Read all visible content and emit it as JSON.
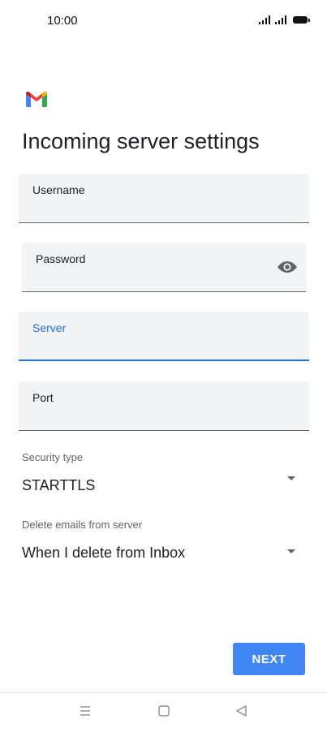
{
  "status_bar": {
    "time": "10:00"
  },
  "app": {
    "logo_icon": "gmail-logo",
    "title": "Incoming server settings"
  },
  "fields": {
    "username": {
      "label": "Username",
      "value": ""
    },
    "password": {
      "label": "Password",
      "value": "",
      "toggle_icon": "eye-icon"
    },
    "server": {
      "label": "Server",
      "value": "",
      "focused": true
    },
    "port": {
      "label": "Port",
      "value": ""
    }
  },
  "security": {
    "caption": "Security type",
    "value": "STARTTLS"
  },
  "delete_emails": {
    "caption": "Delete emails from server",
    "value": "When I delete from Inbox"
  },
  "next_label": "NEXT",
  "nav_bar": {
    "menu_icon": "menu-icon",
    "home_icon": "home-icon",
    "back_icon": "back-icon"
  },
  "colors": {
    "accent": "#1a73e8",
    "button": "#4285f4",
    "field_bg": "#f1f3f4"
  }
}
